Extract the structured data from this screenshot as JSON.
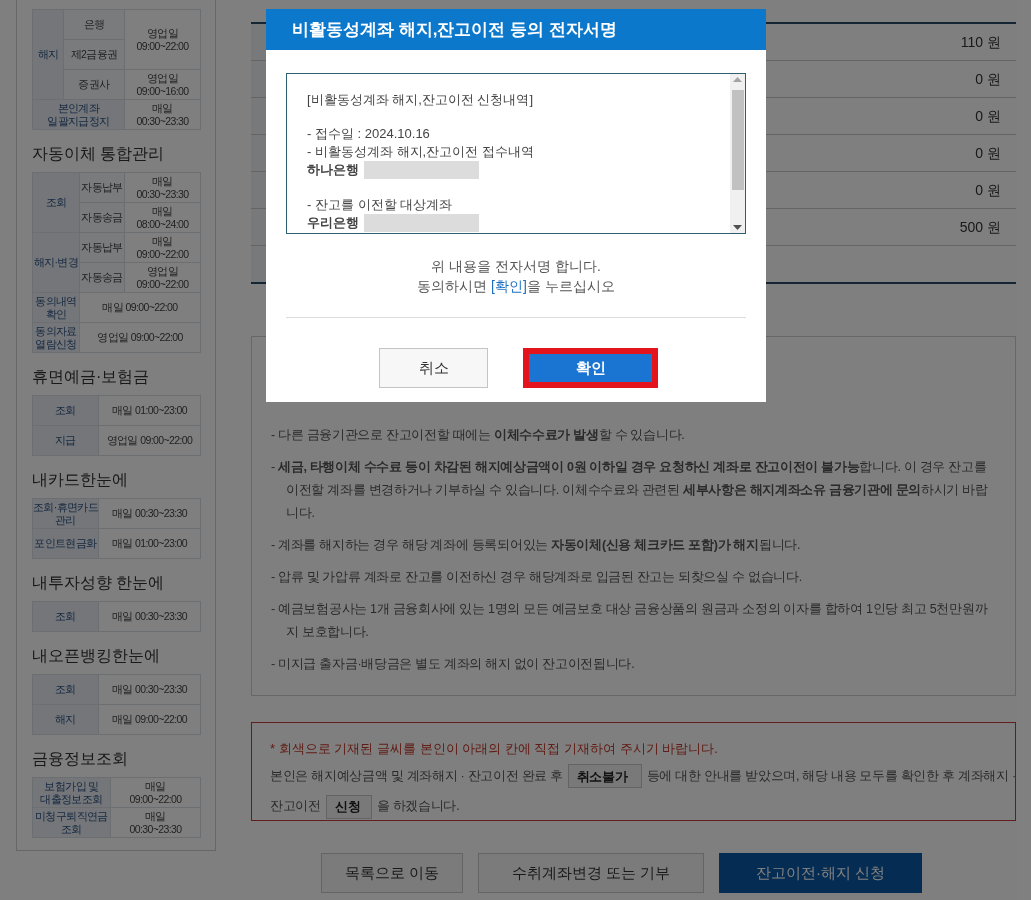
{
  "sidebar": {
    "sections": [
      {
        "rows": [
          [
            {
              "text": "해지",
              "kind": "head",
              "rowspan": 3
            },
            {
              "text": "은행",
              "kind": "sub"
            },
            {
              "text": "영업일\n09:00~22:00",
              "kind": "value",
              "rowspan": 2
            }
          ],
          [
            {
              "text": "제2금융권",
              "kind": "sub"
            }
          ],
          [
            {
              "text": "증권사",
              "kind": "sub"
            },
            {
              "text": "영업일\n09:00~16:00",
              "kind": "value"
            }
          ],
          [
            {
              "text": "본인계좌\n일괄지급정지",
              "kind": "head",
              "colspan": 2
            },
            {
              "text": "매일\n00:30~23:30",
              "kind": "value"
            }
          ]
        ]
      },
      {
        "title": "자동이체 통합관리",
        "rows": [
          [
            {
              "text": "조회",
              "kind": "head",
              "rowspan": 2
            },
            {
              "text": "자동납부",
              "kind": "sub"
            },
            {
              "text": "매일\n00:30~23:30",
              "kind": "value"
            }
          ],
          [
            {
              "text": "자동송금",
              "kind": "sub"
            },
            {
              "text": "매일\n08:00~24:00",
              "kind": "value"
            }
          ],
          [
            {
              "text": "해지·변경",
              "kind": "head",
              "rowspan": 2
            },
            {
              "text": "자동납부",
              "kind": "sub"
            },
            {
              "text": "매일\n09:00~22:00",
              "kind": "value"
            }
          ],
          [
            {
              "text": "자동송금",
              "kind": "sub"
            },
            {
              "text": "영업일\n09:00~22:00",
              "kind": "value"
            }
          ],
          [
            {
              "text": "동의내역\n확인",
              "kind": "head"
            },
            {
              "text": "매일 09:00~22:00",
              "kind": "value",
              "colspan": 2
            }
          ],
          [
            {
              "text": "동의자료\n열람신청",
              "kind": "head"
            },
            {
              "text": "영업일 09:00~22:00",
              "kind": "value",
              "colspan": 2
            }
          ]
        ]
      },
      {
        "title": "휴면예금·보험금",
        "rows": [
          [
            {
              "text": "조회",
              "kind": "head"
            },
            {
              "text": "매일 01:00~23:00",
              "kind": "value"
            }
          ],
          [
            {
              "text": "지급",
              "kind": "head"
            },
            {
              "text": "영업일 09:00~22:00",
              "kind": "value"
            }
          ]
        ]
      },
      {
        "title": "내카드한눈에",
        "rows": [
          [
            {
              "text": "조회·휴면카드\n관리",
              "kind": "head"
            },
            {
              "text": "매일 00:30~23:30",
              "kind": "value"
            }
          ],
          [
            {
              "text": "포인트현금화",
              "kind": "head"
            },
            {
              "text": "매일 01:00~23:00",
              "kind": "value"
            }
          ]
        ]
      },
      {
        "title": "내투자성향 한눈에",
        "rows": [
          [
            {
              "text": "조회",
              "kind": "head"
            },
            {
              "text": "매일 00:30~23:30",
              "kind": "value"
            }
          ]
        ]
      },
      {
        "title": "내오픈뱅킹한눈에",
        "rows": [
          [
            {
              "text": "조회",
              "kind": "head"
            },
            {
              "text": "매일 00:30~23:30",
              "kind": "value"
            }
          ],
          [
            {
              "text": "해지",
              "kind": "head"
            },
            {
              "text": "매일 09:00~22:00",
              "kind": "value"
            }
          ]
        ]
      },
      {
        "title": "금융정보조회",
        "rows": [
          [
            {
              "text": "보험가입 및\n대출정보조회",
              "kind": "head"
            },
            {
              "text": "매일\n09:00~22:00",
              "kind": "value"
            }
          ],
          [
            {
              "text": "미청구퇴직연금\n조회",
              "kind": "head"
            },
            {
              "text": "매일\n00:30~23:30",
              "kind": "value"
            }
          ]
        ]
      }
    ]
  },
  "amounts": [
    "110 원",
    "0 원",
    "0 원",
    "0 원",
    "0 원",
    "500 원"
  ],
  "notices": [
    "- 다른 금융기관으로 잔고이전할 때에는 **이체수수료가 발생**할 수 있습니다.",
    "- **세금, 타행이체 수수료 등이 차감된 해지예상금액이 0원 이하일 경우 요청하신 계좌로 잔고이전이 불가능**합니다. 이 경우 잔고를 이전할 계좌를 변경하거나 기부하실 수 있습니다. 이체수수료와 관련된 **세부사항은 해지계좌소유 금융기관에 문의**하시기 바랍니다.",
    "- 계좌를 해지하는 경우 해당 계좌에 등록되어있는 **자동이체(신용 체크카드 포함)가 해지**됩니다.",
    "- 압류 및 가압류 계좌로 잔고를 이전하신 경우 해당계좌로 입금된 잔고는 되찾으실 수 없습니다.",
    "- 예금보험공사는 1개 금융회사에 있는 1명의 모든 예금보호 대상 금융상품의 원금과 소정의 이자를 합하여 1인당 최고 5천만원까지 보호합니다.",
    "- 미지급 출자금·배당금은 별도 계좌의 해지 없이 잔고이전됩니다."
  ],
  "consent": {
    "instruction": "* 회색으로 기재된 글씨를 본인이 아래의 칸에 직접 기재하여 주시기 바랍니다.",
    "lines": [
      [
        {
          "kind": "text",
          "text": "본인은 해지예상금액 및 계좌해지 · 잔고이전 완료 후"
        },
        {
          "kind": "input",
          "placeholder": "취소불가"
        },
        {
          "kind": "text",
          "text": "등에 대한 안내를 받았으며, 해당 내용 모두를 확인한 후 계좌해지 ·"
        }
      ],
      [
        {
          "kind": "text",
          "text": "잔고이전"
        },
        {
          "kind": "input",
          "placeholder": "신청"
        },
        {
          "kind": "text",
          "text": "을 하겠습니다."
        }
      ]
    ]
  },
  "buttons": [
    {
      "label": "목록으로 이동",
      "kind": "secondary"
    },
    {
      "label": "수취계좌변경 또는 기부",
      "kind": "secondary"
    },
    {
      "label": "잔고이전·해지 신청",
      "kind": "primary"
    }
  ],
  "dialog": {
    "title": "비활동성계좌 해지,잔고이전 등의 전자서명",
    "lines": [
      {
        "kind": "text",
        "text": "[비활동성계좌 해지,잔고이전 신청내역]"
      },
      {
        "kind": "blank"
      },
      {
        "kind": "text",
        "text": "- 접수일 : 2024.10.16"
      },
      {
        "kind": "text",
        "text": "- 비활동성계좌 해지,잔고이전 접수내역"
      },
      {
        "kind": "redacted",
        "text": "하나은행"
      },
      {
        "kind": "blank"
      },
      {
        "kind": "text",
        "text": "- 잔고를 이전할 대상계좌"
      },
      {
        "kind": "redacted",
        "text": "우리은행"
      }
    ],
    "message": "위 내용을 전자서명 합니다.",
    "prompt": {
      "before": "동의하시면 ",
      "highlight": "[확인]",
      "after": "을 누르십시오"
    },
    "buttons": [
      {
        "label": "취소",
        "kind": "secondary",
        "annotated": false
      },
      {
        "label": "확인",
        "kind": "primary",
        "annotated": true
      }
    ]
  }
}
